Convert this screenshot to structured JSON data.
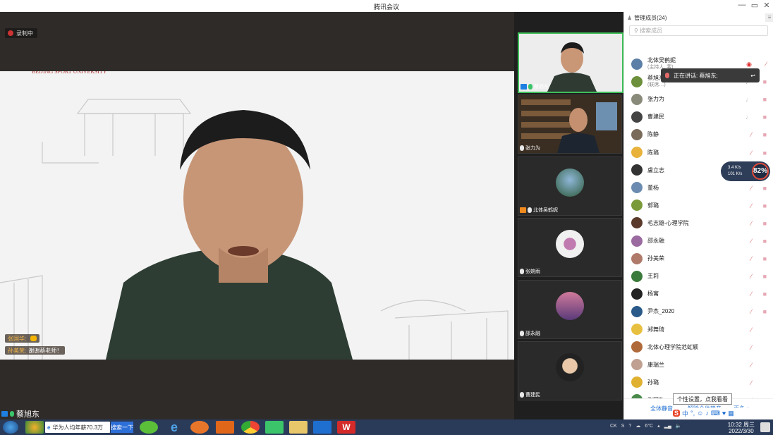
{
  "window": {
    "title": "腾讯会议",
    "controls": [
      "—",
      "▭",
      "✕"
    ]
  },
  "stage": {
    "recording_label": "录制中",
    "active_speaker_name": "蔡旭东",
    "chat_messages": [
      {
        "sender": "张国华:",
        "text": ""
      },
      {
        "sender": "孙美荣:",
        "text": "谢谢蔡老师！"
      }
    ]
  },
  "thumbnails": [
    {
      "name": "蔡旭东",
      "host": true,
      "type": "video"
    },
    {
      "name": "张力为",
      "host": false,
      "type": "video"
    },
    {
      "name": "北体吴鹤妮",
      "host": true,
      "type": "avatar"
    },
    {
      "name": "张婉雨",
      "host": false,
      "type": "avatar"
    },
    {
      "name": "邵永融",
      "host": false,
      "type": "avatar"
    },
    {
      "name": "曹建民",
      "host": false,
      "type": "avatar"
    }
  ],
  "panel": {
    "header": "管理成员(24)",
    "search_placeholder": "搜索成员",
    "speaking_banner": "正在讲话: 蔡旭东;",
    "members": [
      {
        "name": "北体吴鹤妮",
        "sub": "(主持人, 我)",
        "mic": "rec",
        "cam": "muted",
        "color": "#5c7fa7"
      },
      {
        "name": "蔡旭东",
        "sub": "(联席…)",
        "mic": "on",
        "cam": "on",
        "color": "#6b8f3a"
      },
      {
        "name": "张力为",
        "sub": "",
        "mic": "on",
        "cam": "on",
        "color": "#8a8a7a"
      },
      {
        "name": "曹建民",
        "sub": "",
        "mic": "on",
        "cam": "on",
        "color": "#444"
      },
      {
        "name": "陈静",
        "sub": "",
        "mic": "muted",
        "cam": "on",
        "color": "#7a6a5a"
      },
      {
        "name": "陈璐",
        "sub": "",
        "mic": "muted",
        "cam": "on",
        "color": "#e8b23b"
      },
      {
        "name": "盧立志",
        "sub": "",
        "mic": "muted",
        "cam": "on",
        "color": "#333"
      },
      {
        "name": "董杨",
        "sub": "",
        "mic": "muted",
        "cam": "on",
        "color": "#6b8cb0"
      },
      {
        "name": "郭璐",
        "sub": "",
        "mic": "muted",
        "cam": "on",
        "color": "#7a9a3a"
      },
      {
        "name": "毛志雄-心理学院",
        "sub": "",
        "mic": "muted",
        "cam": "on",
        "color": "#5a3a2a"
      },
      {
        "name": "邵永融",
        "sub": "",
        "mic": "muted",
        "cam": "on",
        "color": "#9a6aa0"
      },
      {
        "name": "孙美荣",
        "sub": "",
        "mic": "muted",
        "cam": "on",
        "color": "#b07a6a"
      },
      {
        "name": "王莉",
        "sub": "",
        "mic": "muted",
        "cam": "on",
        "color": "#3a7a3a"
      },
      {
        "name": "杨寓",
        "sub": "",
        "mic": "muted",
        "cam": "on",
        "color": "#222"
      },
      {
        "name": "尹杰_2020",
        "sub": "",
        "mic": "muted",
        "cam": "on",
        "color": "#2a5a8a"
      },
      {
        "name": "郑舞琦",
        "sub": "",
        "mic": "muted",
        "cam": "none",
        "color": "#e8c040"
      },
      {
        "name": "北体心理学院范虹颖",
        "sub": "",
        "mic": "muted",
        "cam": "none",
        "color": "#b06a3a"
      },
      {
        "name": "康瑞兰",
        "sub": "",
        "mic": "muted",
        "cam": "none",
        "color": "#c0a090"
      },
      {
        "name": "孙璐",
        "sub": "",
        "mic": "muted",
        "cam": "none",
        "color": "#e0b030"
      },
      {
        "name": "张国礼",
        "sub": "",
        "mic": "muted",
        "cam": "none",
        "color": "#4a8a4a"
      }
    ],
    "footer": {
      "mute_all": "全体静音",
      "unmute_all": "解除全体静音",
      "more": "更多 ▾"
    },
    "tooltip": "个性设置，点我看看",
    "net": {
      "up": "3.4 K/s",
      "down": "101 K/s",
      "percent": "82%"
    }
  },
  "taskbar": {
    "search_text": "华为人均年薪70.3万",
    "search_button": "搜索一下",
    "tray_text": "CK",
    "temperature": "6°C",
    "time": "10:32 周三",
    "date": "2022/3/30"
  }
}
